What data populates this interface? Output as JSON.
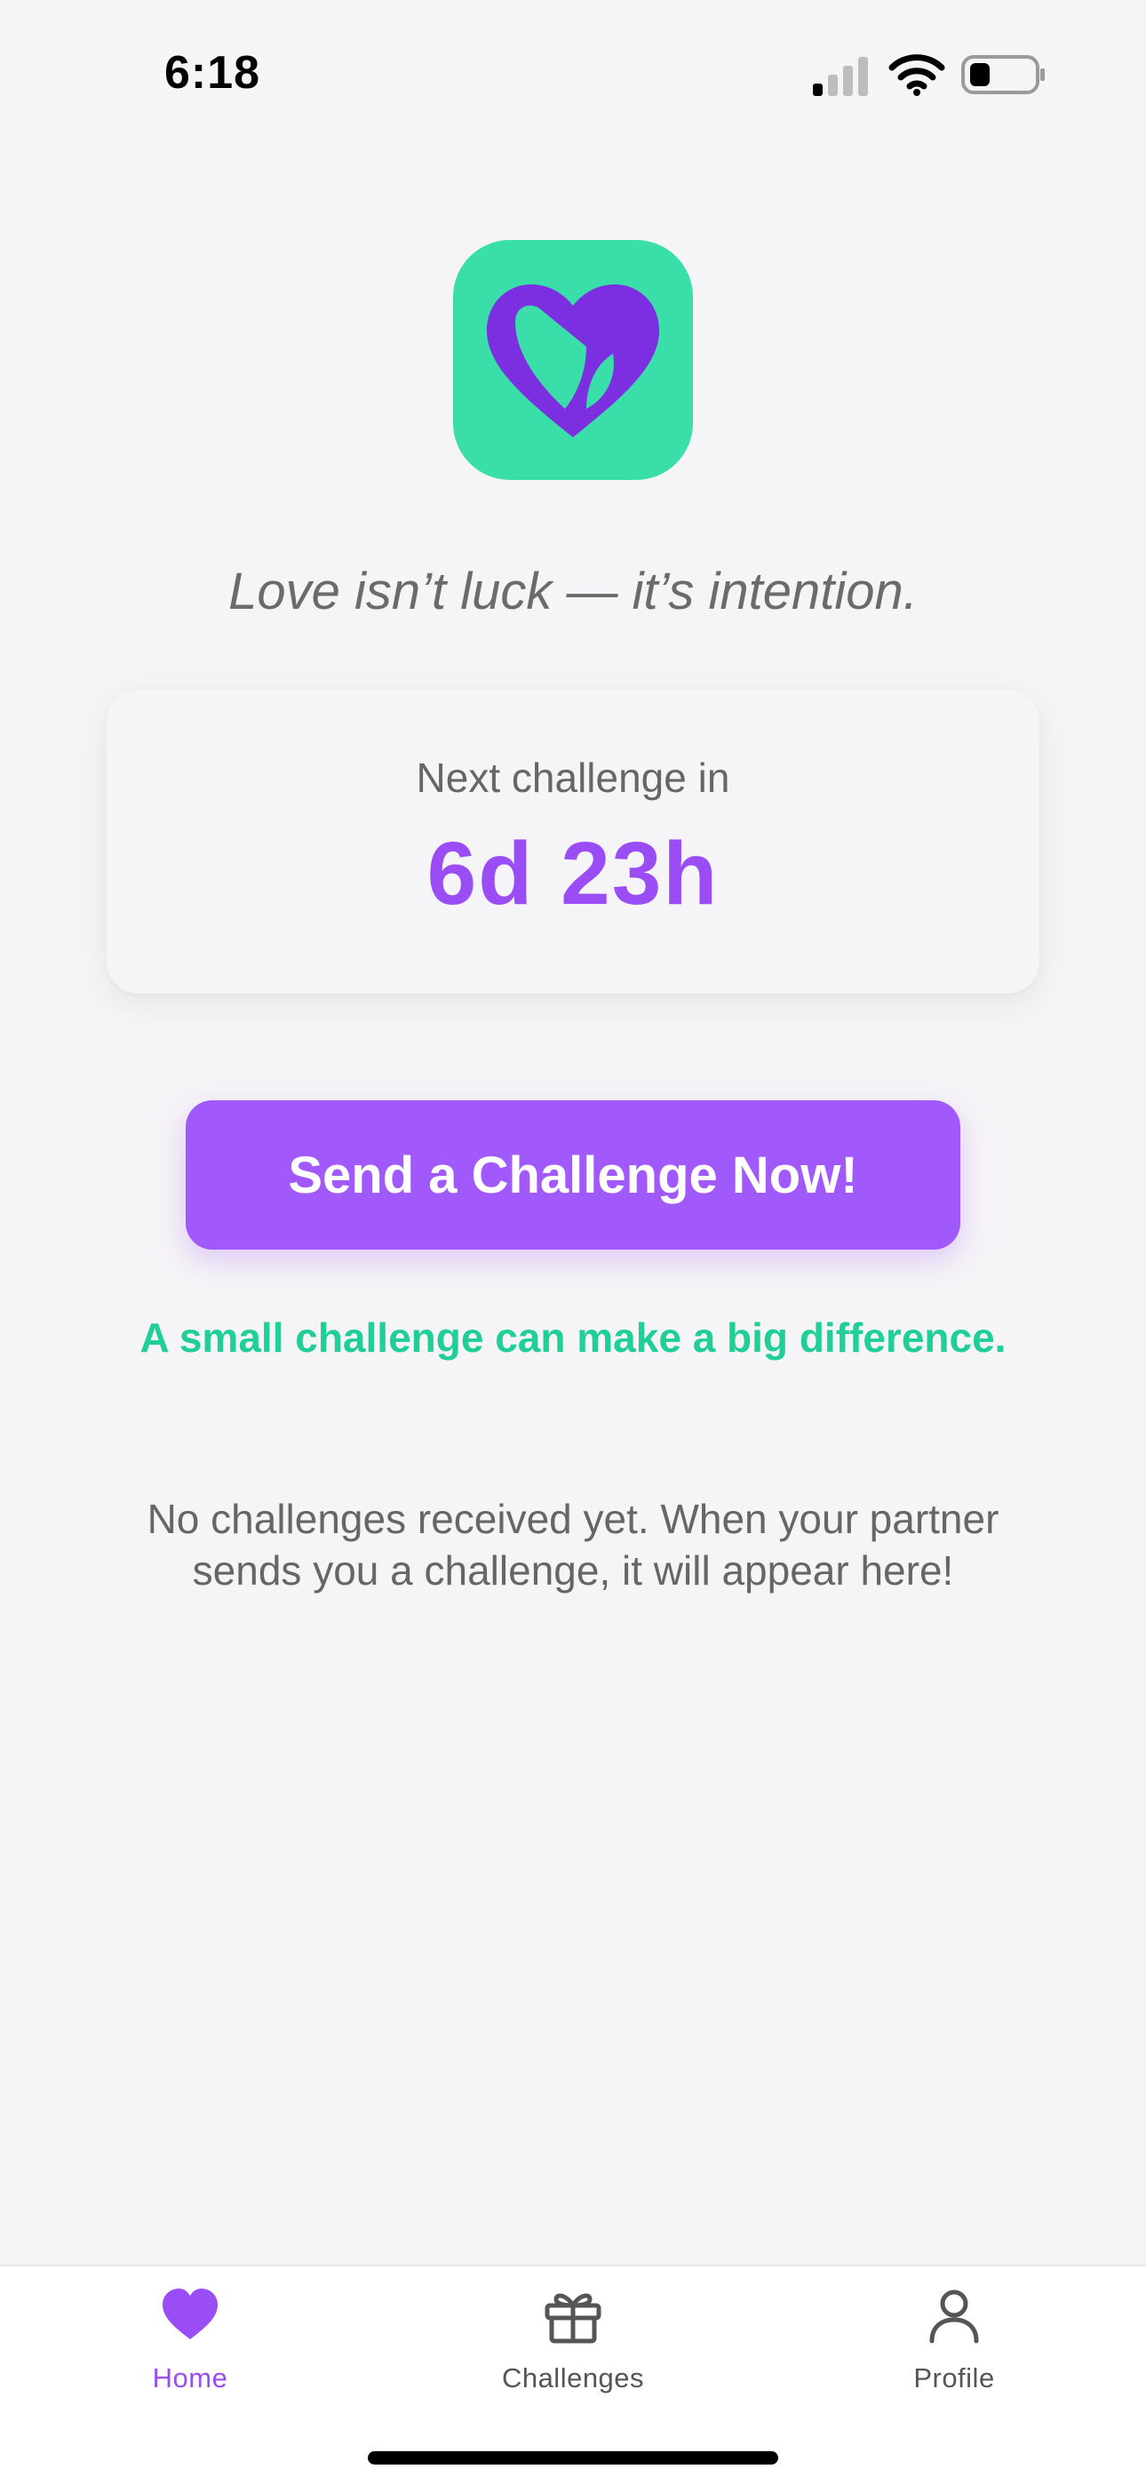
{
  "status_bar": {
    "time": "6:18"
  },
  "main": {
    "tagline": "Love isn’t luck — it’s intention.",
    "countdown": {
      "label": "Next challenge in",
      "value": "6d 23h"
    },
    "send_button_label": "Send a Challenge Now!",
    "encouragement": "A small challenge can make a big difference.",
    "empty_state": "No challenges received yet. When your partner sends you a challenge, it will appear here!"
  },
  "tab_bar": {
    "items": [
      {
        "label": "Home",
        "icon": "heart-icon",
        "active": true
      },
      {
        "label": "Challenges",
        "icon": "gift-icon",
        "active": false
      },
      {
        "label": "Profile",
        "icon": "person-icon",
        "active": false
      }
    ]
  },
  "colors": {
    "accent_purple": "#a259fb",
    "accent_green": "#1fcf95",
    "logo_background": "#39dea9",
    "logo_heart": "#7b2fe0",
    "background": "#f5f4f6"
  }
}
